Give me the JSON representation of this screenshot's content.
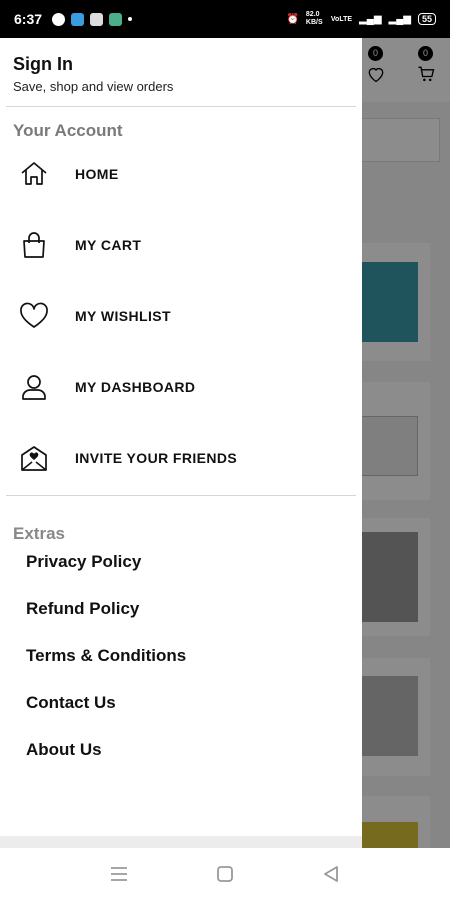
{
  "status_bar": {
    "time": "6:37",
    "right_text": [
      "82.0 KB/S",
      "VoLTE"
    ],
    "battery": "55"
  },
  "background": {
    "wishlist_count": "0",
    "cart_count": "0"
  },
  "drawer": {
    "signin_title": "Sign In",
    "signin_subtitle": "Save, shop and view orders",
    "account_title": "Your Account",
    "items": [
      {
        "label": "HOME",
        "icon": "home-icon"
      },
      {
        "label": "MY CART",
        "icon": "shopping-bag-icon"
      },
      {
        "label": "MY WISHLIST",
        "icon": "heart-icon"
      },
      {
        "label": "MY DASHBOARD",
        "icon": "user-icon"
      },
      {
        "label": "INVITE YOUR FRIENDS",
        "icon": "invite-envelope-icon"
      }
    ],
    "extras_title": "Extras",
    "extras": [
      {
        "label": "Privacy Policy"
      },
      {
        "label": "Refund Policy"
      },
      {
        "label": "Terms & Conditions"
      },
      {
        "label": "Contact Us"
      },
      {
        "label": "About Us"
      }
    ]
  },
  "colors": {
    "section_gray": "#7a7a7a",
    "overlay": "rgba(0,0,0,0.45)"
  }
}
